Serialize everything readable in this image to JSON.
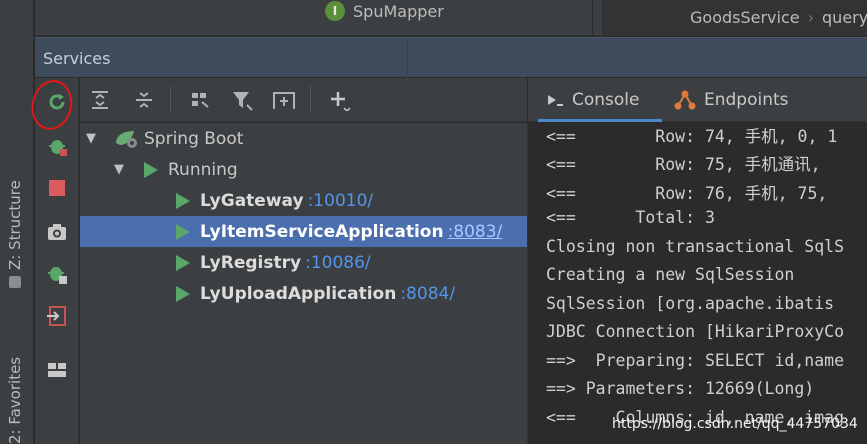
{
  "editor": {
    "tab_label": "SpuMapper",
    "tab_icon_letter": "I",
    "breadcrumb": [
      "GoodsService",
      "queryS"
    ]
  },
  "left_strip": {
    "structure_label": "Z: Structure",
    "favorites_label": "2: Favorites"
  },
  "services": {
    "title": "Services",
    "vertical_actions": [
      {
        "name": "rerun-icon"
      },
      {
        "name": "debug-icon"
      },
      {
        "name": "stop-icon"
      },
      {
        "name": "snapshot-icon"
      },
      {
        "name": "debug-configuration-icon"
      },
      {
        "name": "open-in-tool-window-icon"
      },
      {
        "name": "layout-icon"
      }
    ],
    "toolbar_actions": [
      {
        "name": "expand-all-icon"
      },
      {
        "name": "collapse-all-icon"
      },
      {
        "name": "group-by-icon"
      },
      {
        "name": "filter-icon"
      },
      {
        "name": "new-tab-icon"
      },
      {
        "name": "add-service-icon"
      }
    ],
    "tree": {
      "root": "Spring Boot",
      "group": "Running",
      "apps": [
        {
          "name": "LyGateway",
          "port": ":10010/"
        },
        {
          "name": "LyItemServiceApplication",
          "port": ":8083/"
        },
        {
          "name": "LyRegistry",
          "port": ":10086/"
        },
        {
          "name": "LyUploadApplication",
          "port": ":8084/"
        }
      ]
    }
  },
  "console": {
    "tabs": [
      "Console",
      "Endpoints"
    ],
    "lines": [
      "<==        Row: 74, 手机, 0, 1",
      "<==        Row: 75, 手机通讯,",
      "<==        Row: 76, 手机, 75,",
      "<==      Total: 3",
      "Closing non transactional SqlS",
      "Creating a new SqlSession",
      "SqlSession [org.apache.ibatis",
      "JDBC Connection [HikariProxyCo",
      "==>  Preparing: SELECT id,name",
      "==> Parameters: 12669(Long)",
      "<==    Columns: id, name, imag"
    ],
    "watermark": "https://blog.csdn.net/qq_44757034"
  },
  "colors": {
    "selection": "#4b6eaf",
    "running_green": "#59a869",
    "port_blue": "#5394ec",
    "header_blue": "#3d4b5c"
  }
}
